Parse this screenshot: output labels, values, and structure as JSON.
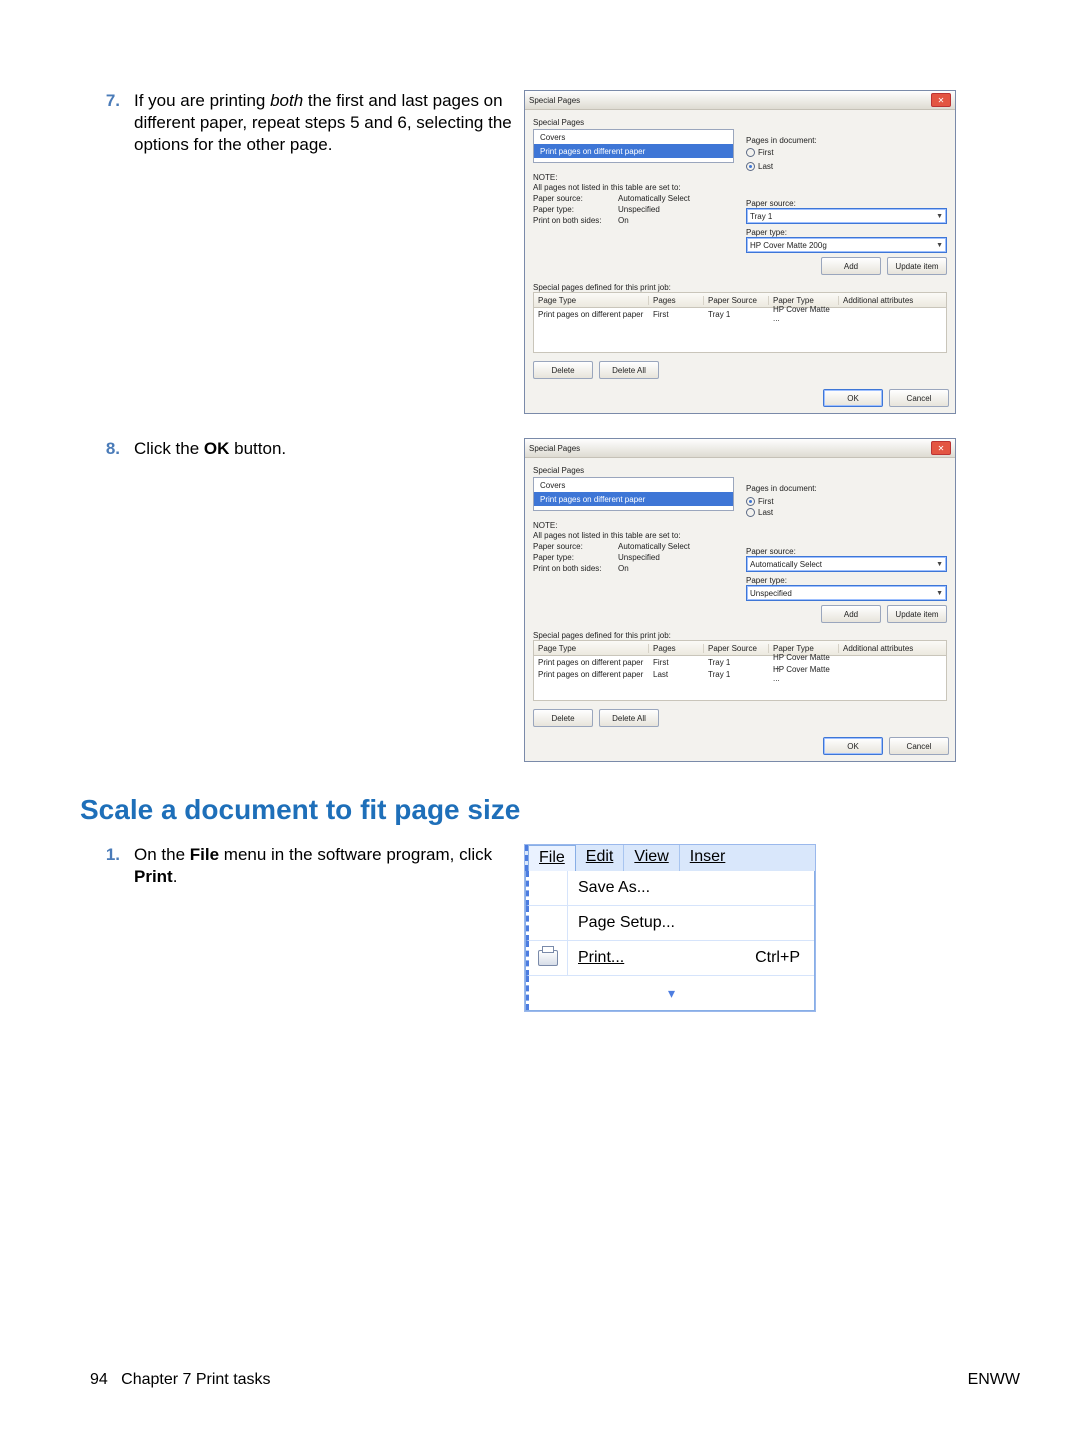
{
  "steps": {
    "n7": {
      "num": "7.",
      "text_a": "If you are printing ",
      "em": "both",
      "text_b": " the first and last pages on different paper, repeat steps 5 and 6, selecting the options for the other page."
    },
    "n8": {
      "num": "8.",
      "text_a": "Click the ",
      "bold": "OK",
      "text_b": " button."
    },
    "sect_head": "Scale a document to fit page size",
    "n1": {
      "num": "1.",
      "text_a": "On the ",
      "bold1": "File",
      "text_b": " menu in the software program, click ",
      "bold2": "Print",
      "text_c": "."
    }
  },
  "dlgA": {
    "title": "Special Pages",
    "grpLabel": "Special Pages",
    "listCovers": "Covers",
    "listPrint": "Print pages on different paper",
    "pagesInDoc": "Pages in document:",
    "rFirst": "First",
    "rLast": "Last",
    "noteHd": "NOTE:",
    "noteTxt": "All pages not listed in this table are set to:",
    "kSource": "Paper source:",
    "vSource": "Automatically Select",
    "kType": "Paper type:",
    "vType": "Unspecified",
    "kBoth": "Print on both sides:",
    "vBoth": "On",
    "rPaperSource": "Paper source:",
    "rPaperSourceVal": "Tray 1",
    "rPaperType": "Paper type:",
    "rPaperTypeVal": "HP Cover Matte 200g",
    "btnAdd": "Add",
    "btnUpdate": "Update item",
    "tblCaption": "Special pages defined for this print job:",
    "hPageType": "Page Type",
    "hPages": "Pages",
    "hSource": "Paper Source",
    "hPType": "Paper Type",
    "hAttr": "Additional attributes",
    "row1": {
      "c1": "Print pages on different paper",
      "c2": "First",
      "c3": "Tray 1",
      "c4": "HP Cover Matte ..."
    },
    "btnDelete": "Delete",
    "btnDeleteAll": "Delete All",
    "btnOK": "OK",
    "btnCancel": "Cancel"
  },
  "dlgB": {
    "title": "Special Pages",
    "grpLabel": "Special Pages",
    "listCovers": "Covers",
    "listPrint": "Print pages on different paper",
    "pagesInDoc": "Pages in document:",
    "rFirst": "First",
    "rLast": "Last",
    "noteHd": "NOTE:",
    "noteTxt": "All pages not listed in this table are set to:",
    "kSource": "Paper source:",
    "vSource": "Automatically Select",
    "kType": "Paper type:",
    "vType": "Unspecified",
    "kBoth": "Print on both sides:",
    "vBoth": "On",
    "rPaperSource": "Paper source:",
    "rPaperSourceVal": "Automatically Select",
    "rPaperType": "Paper type:",
    "rPaperTypeVal": "Unspecified",
    "btnAdd": "Add",
    "btnUpdate": "Update item",
    "tblCaption": "Special pages defined for this print job:",
    "hPageType": "Page Type",
    "hPages": "Pages",
    "hSource": "Paper Source",
    "hPType": "Paper Type",
    "hAttr": "Additional attributes",
    "row1": {
      "c1": "Print pages on different paper",
      "c2": "First",
      "c3": "Tray 1",
      "c4": "HP Cover Matte ..."
    },
    "row2": {
      "c1": "Print pages on different paper",
      "c2": "Last",
      "c3": "Tray 1",
      "c4": "HP Cover Matte ..."
    },
    "btnDelete": "Delete",
    "btnDeleteAll": "Delete All",
    "btnOK": "OK",
    "btnCancel": "Cancel"
  },
  "menu": {
    "file": "File",
    "edit": "Edit",
    "view": "View",
    "insert": "Inser",
    "saveAs": "Save As...",
    "pageSetup": "Page Setup...",
    "print": "Print...",
    "shortcut": "Ctrl+P"
  },
  "footer": {
    "left_a": "94",
    "left_b": "Chapter 7   Print tasks",
    "right": "ENWW"
  }
}
